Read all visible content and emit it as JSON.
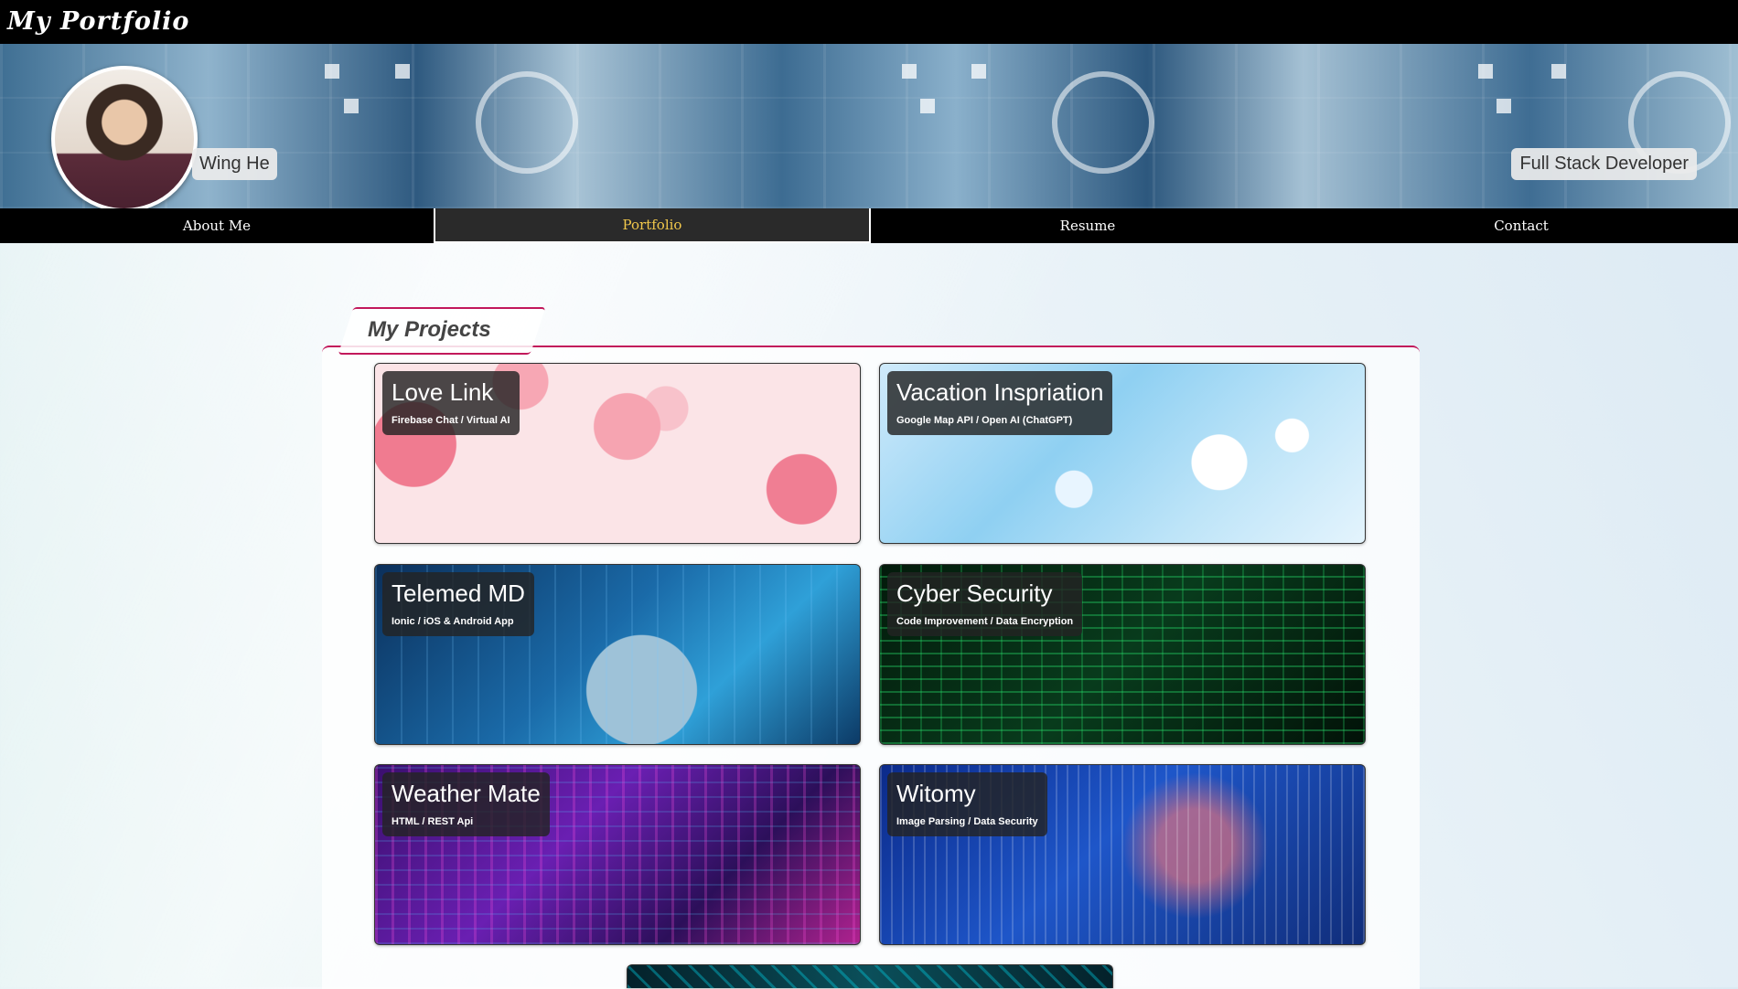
{
  "header": {
    "brand": "My Portfolio"
  },
  "profile": {
    "name": "Wing He",
    "title": "Full Stack Developer"
  },
  "nav": {
    "items": [
      {
        "label": "About Me",
        "active": false
      },
      {
        "label": "Portfolio",
        "active": true
      },
      {
        "label": "Resume",
        "active": false
      },
      {
        "label": "Contact",
        "active": false
      }
    ]
  },
  "projects": {
    "heading": "My Projects",
    "items": [
      {
        "title": "Love Link",
        "subtitle": "Firebase Chat / Virtual AI"
      },
      {
        "title": "Vacation Inspriation",
        "subtitle": "Google Map API / Open AI (ChatGPT)"
      },
      {
        "title": "Telemed MD",
        "subtitle": "Ionic / iOS & Android App"
      },
      {
        "title": "Cyber Security",
        "subtitle": "Code Improvement / Data Encryption"
      },
      {
        "title": "Weather Mate",
        "subtitle": "HTML / REST Api"
      },
      {
        "title": "Witomy",
        "subtitle": "Image Parsing / Data Security"
      }
    ]
  },
  "colors": {
    "accent": "#c2185b",
    "active_nav_text": "#f2c84b",
    "nav_bg": "#000000"
  }
}
